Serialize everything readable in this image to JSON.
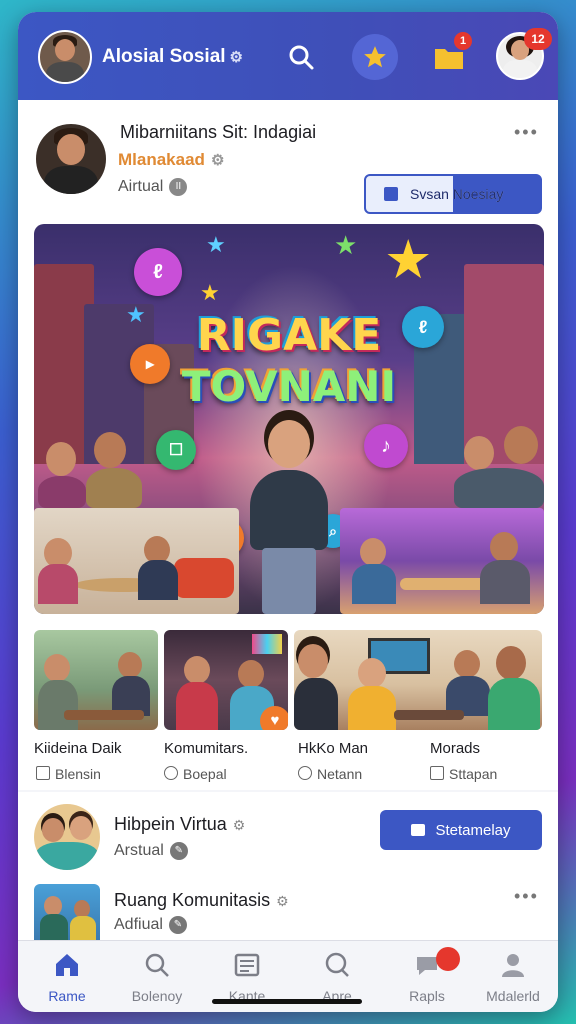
{
  "header": {
    "app_name": "Alosial Sosial",
    "badge_folder": "1",
    "badge_profile": "12",
    "icons": [
      "search-icon",
      "star-icon",
      "folder-icon",
      "gear-icon"
    ]
  },
  "post1": {
    "title": "Mibarniitans Sit: Indagiai",
    "subtitle": "Mlanakaad",
    "meta": "Airtual",
    "follow_label": "Svsan Noesiay"
  },
  "hero": {
    "line1": "RIGAKE",
    "line2": "TOVNANI"
  },
  "thumbs": [
    {
      "label": "Kiideina Daik",
      "meta": "Blensin"
    },
    {
      "label": "Komumitars.",
      "meta": "Boepal"
    },
    {
      "label": "HkKo Man",
      "meta": "Netann"
    },
    {
      "label": "Morads",
      "meta": "Sttapan"
    }
  ],
  "rows": [
    {
      "title": "Hibpein Virtua",
      "meta": "Arstual",
      "button": "Stetamelay"
    },
    {
      "title": "Ruang Komunitasis",
      "meta": "Adfiual"
    }
  ],
  "tabs": [
    {
      "label": "Rame",
      "icon": "home-icon"
    },
    {
      "label": "Bolenoy",
      "icon": "search-icon"
    },
    {
      "label": "Kante",
      "icon": "news-icon"
    },
    {
      "label": "Apre",
      "icon": "search-icon"
    },
    {
      "label": "Rapls",
      "icon": "chat-icon"
    },
    {
      "label": "Mdalerld",
      "icon": "profile-icon"
    }
  ],
  "colors": {
    "brand": "#3c57c4",
    "accent": "#e08a34",
    "badge": "#e5372d"
  }
}
